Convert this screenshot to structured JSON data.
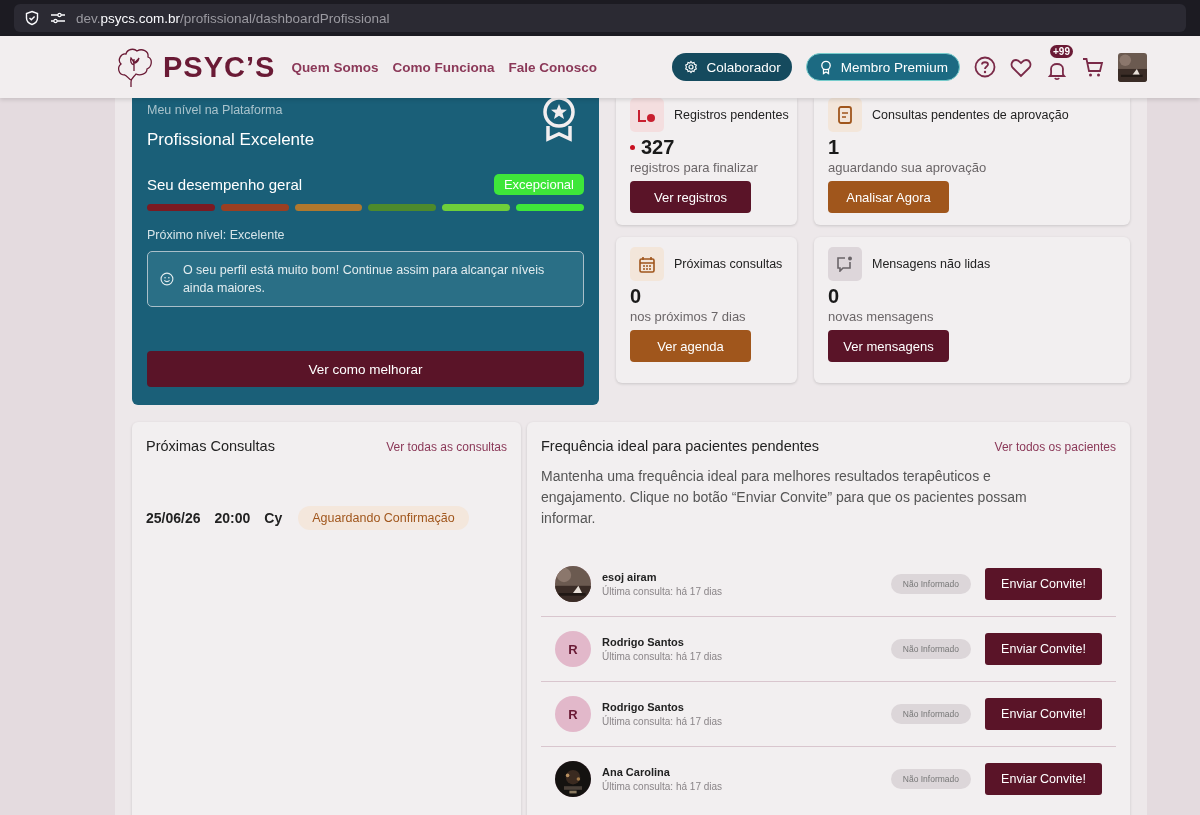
{
  "browser": {
    "url": "dev.**psycs.com.br**/profissional/dashboardProfissional"
  },
  "header": {
    "brand": "PSYC’S",
    "nav": [
      "Quem Somos",
      "Como Funciona",
      "Fale Conosco"
    ],
    "buttons": [
      {
        "label": "Colaborador",
        "kind": "dark"
      },
      {
        "label": "Membro Premium",
        "kind": "light"
      }
    ],
    "notifications": "+99"
  },
  "level_card": {
    "label": "Meu nível na Plataforma",
    "level": "Profissional Excelente",
    "performance_label": "Seu desempenho geral",
    "performance_badge": "Excepcional",
    "segments": [
      {
        "color": "#7a1a22"
      },
      {
        "color": "#9a3f22"
      },
      {
        "color": "#b0782e"
      },
      {
        "color": "#4d8a2c"
      },
      {
        "color": "#6ecf3a"
      },
      {
        "color": "#3ee63a"
      }
    ],
    "next_level": "Próximo nível: Excelente",
    "message": "O seu perfil está muito bom! Continue assim para alcançar níveis ainda maiores.",
    "button": "Ver como melhorar"
  },
  "stat_cards": [
    {
      "title": "Registros pendentes",
      "value": "327",
      "alert": true,
      "caption": "registros para finalizar",
      "button": "Ver registros",
      "kind": "primary"
    },
    {
      "title": "Consultas pendentes de aprovação",
      "value": "1",
      "alert": false,
      "caption": "aguardando sua aprovação",
      "button": "Analisar Agora",
      "kind": "secondary"
    },
    {
      "title": "Próximas consultas",
      "value": "0",
      "alert": false,
      "caption": "nos próximos 7 dias",
      "button": "Ver agenda",
      "kind": "secondary"
    },
    {
      "title": "Mensagens não lidas",
      "value": "0",
      "alert": false,
      "caption": "novas mensagens",
      "button": "Ver mensagens",
      "kind": "primary"
    }
  ],
  "upcoming": {
    "title": "Próximas Consultas",
    "link": "Ver todas as consultas",
    "items": [
      {
        "date": "25/06/26",
        "time": "20:00",
        "name": "Cy",
        "status": "Aguardando Confirmação"
      }
    ]
  },
  "patients": {
    "title": "Frequência ideal para pacientes pendentes",
    "link": "Ver todos os pacientes",
    "description": "Mantenha uma frequência ideal para melhores resultados terapêuticos e engajamento. Clique no botão “Enviar Convite” para que os pacientes possam informar.",
    "rows": [
      {
        "name": "esoj airam",
        "last": "Última consulta: há 17 dias",
        "status": "Não Informado",
        "button": "Enviar Convite!"
      },
      {
        "name": "Rodrigo Santos",
        "last": "Última consulta: há 17 dias",
        "status": "Não Informado",
        "button": "Enviar Convite!",
        "avatar": {
          "kind": "initial",
          "text": "R"
        }
      },
      {
        "name": "Rodrigo Santos",
        "last": "Última consulta: há 17 dias",
        "status": "Não Informado",
        "button": "Enviar Convite!",
        "avatar": {
          "kind": "initial",
          "text": "R"
        }
      },
      {
        "name": "Ana Carolina",
        "last": "Última consulta: há 17 dias",
        "status": "Não Informado",
        "button": "Enviar Convite!"
      }
    ]
  }
}
